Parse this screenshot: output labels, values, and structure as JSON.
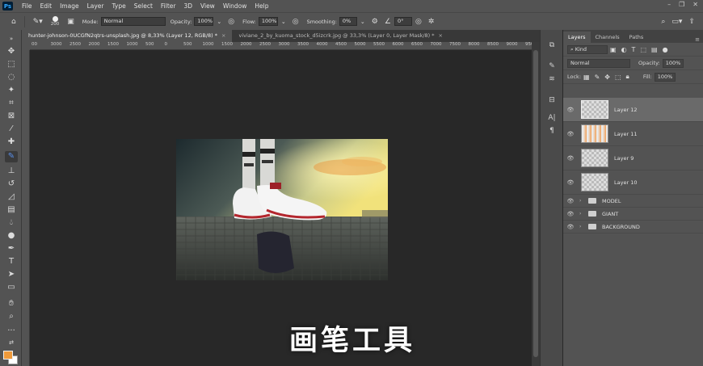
{
  "menubar": {
    "logo": "Ps",
    "items": [
      "File",
      "Edit",
      "Image",
      "Layer",
      "Type",
      "Select",
      "Filter",
      "3D",
      "View",
      "Window",
      "Help"
    ]
  },
  "options": {
    "brush_size": "200",
    "mode_label": "Mode:",
    "mode_value": "Normal",
    "opacity_label": "Opacity:",
    "opacity_value": "100%",
    "flow_label": "Flow:",
    "flow_value": "100%",
    "smoothing_label": "Smoothing:",
    "smoothing_value": "0%",
    "angle_value": "0°"
  },
  "tabs": [
    {
      "label": "hunter-johnson-0UCGfN2qtrs-unsplash.jpg @ 8,33% (Layer 12, RGB/8) *",
      "close": "×"
    },
    {
      "label": "viviane_2_by_kuoma_stock_d5izcrk.jpg @ 33,3% (Layer 0, Layer Mask/8) *",
      "close": "×"
    }
  ],
  "ruler_h": [
    "00",
    "3000",
    "2500",
    "2000",
    "1500",
    "1000",
    "500",
    "0",
    "500",
    "1000",
    "1500",
    "2000",
    "2500",
    "3000",
    "3500",
    "4000",
    "4500",
    "5000",
    "5500",
    "6000",
    "6500",
    "7000",
    "7500",
    "8000",
    "8500",
    "9000",
    "9500",
    "10000",
    "105"
  ],
  "layers_panel": {
    "tabs": [
      "Layers",
      "Channels",
      "Paths"
    ],
    "filter_value": "Kind",
    "blend_value": "Normal",
    "opacity_label": "Opacity:",
    "opacity_value": "100%",
    "lock_label": "Lock:",
    "fill_label": "Fill:",
    "fill_value": "100%",
    "layers": [
      {
        "name": "Layer 12"
      },
      {
        "name": "Layer 11"
      },
      {
        "name": "Layer 9"
      },
      {
        "name": "Layer 10"
      }
    ],
    "groups": [
      {
        "name": "MODEL"
      },
      {
        "name": "GIANT"
      },
      {
        "name": "BACKGROUND"
      }
    ]
  },
  "subtitle": "画笔工具",
  "colors": {
    "foreground": "#ef9a3a",
    "background": "#ffffff",
    "accent": "#31a8ff"
  }
}
